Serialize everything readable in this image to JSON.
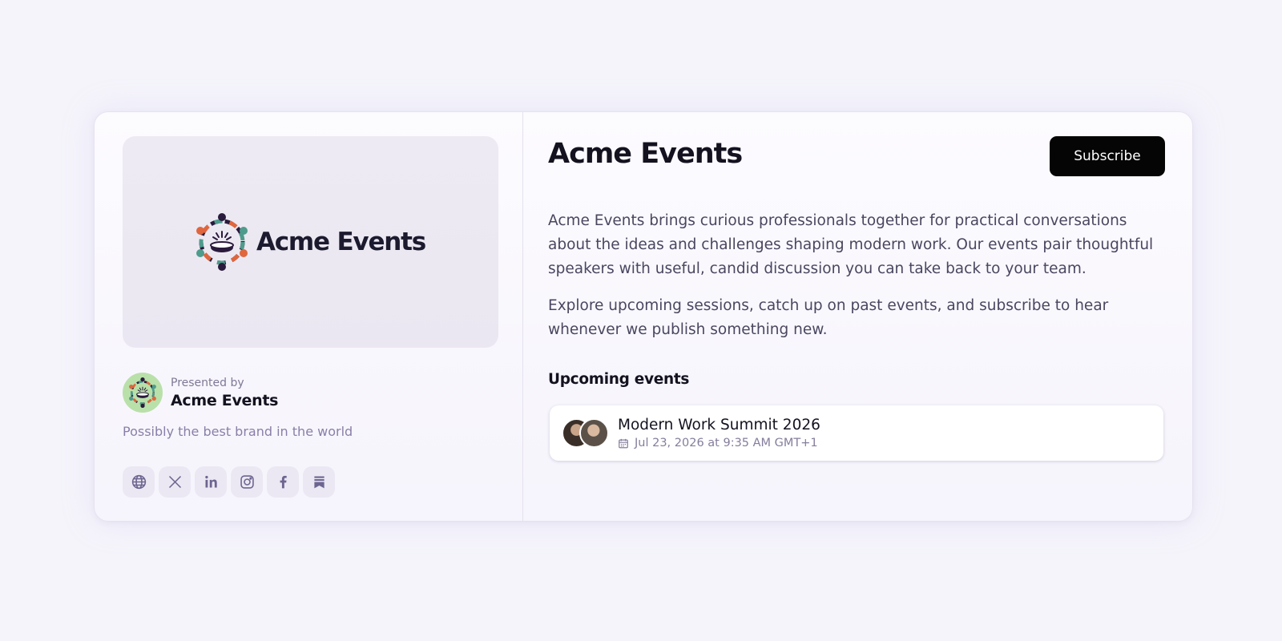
{
  "brand": {
    "name": "Acme Events",
    "banner_wordmark": "Acme Events",
    "presented_by": "Presented by",
    "presenter_name": "Acme Events",
    "tagline": "Possibly the best brand in the world"
  },
  "socials": [
    {
      "icon": "globe-icon"
    },
    {
      "icon": "x-icon"
    },
    {
      "icon": "linkedin-icon"
    },
    {
      "icon": "instagram-icon"
    },
    {
      "icon": "facebook-icon"
    },
    {
      "icon": "substack-icon"
    }
  ],
  "header": {
    "title": "Acme Events",
    "subscribe_label": "Subscribe"
  },
  "description": {
    "p1": "Acme Events brings curious professionals together for practical conversations about the ideas and challenges shaping modern work. Our events pair thoughtful speakers with useful, candid discussion you can take back to your team.",
    "p2": "Explore upcoming sessions, catch up on past events, and subscribe to hear whenever we publish something new."
  },
  "upcoming": {
    "heading": "Upcoming events",
    "events": [
      {
        "title": "Modern Work Summit 2026",
        "date": "Jul 23, 2026 at 9:35 AM GMT+1"
      }
    ]
  },
  "colors": {
    "logo_orange": "#e0663d",
    "logo_teal": "#4f9b8c",
    "logo_dark": "#2a1a3c",
    "avatar_bg": "#b9e0a9",
    "button_bg": "#050505",
    "muted_purple": "#8a7fa8"
  }
}
